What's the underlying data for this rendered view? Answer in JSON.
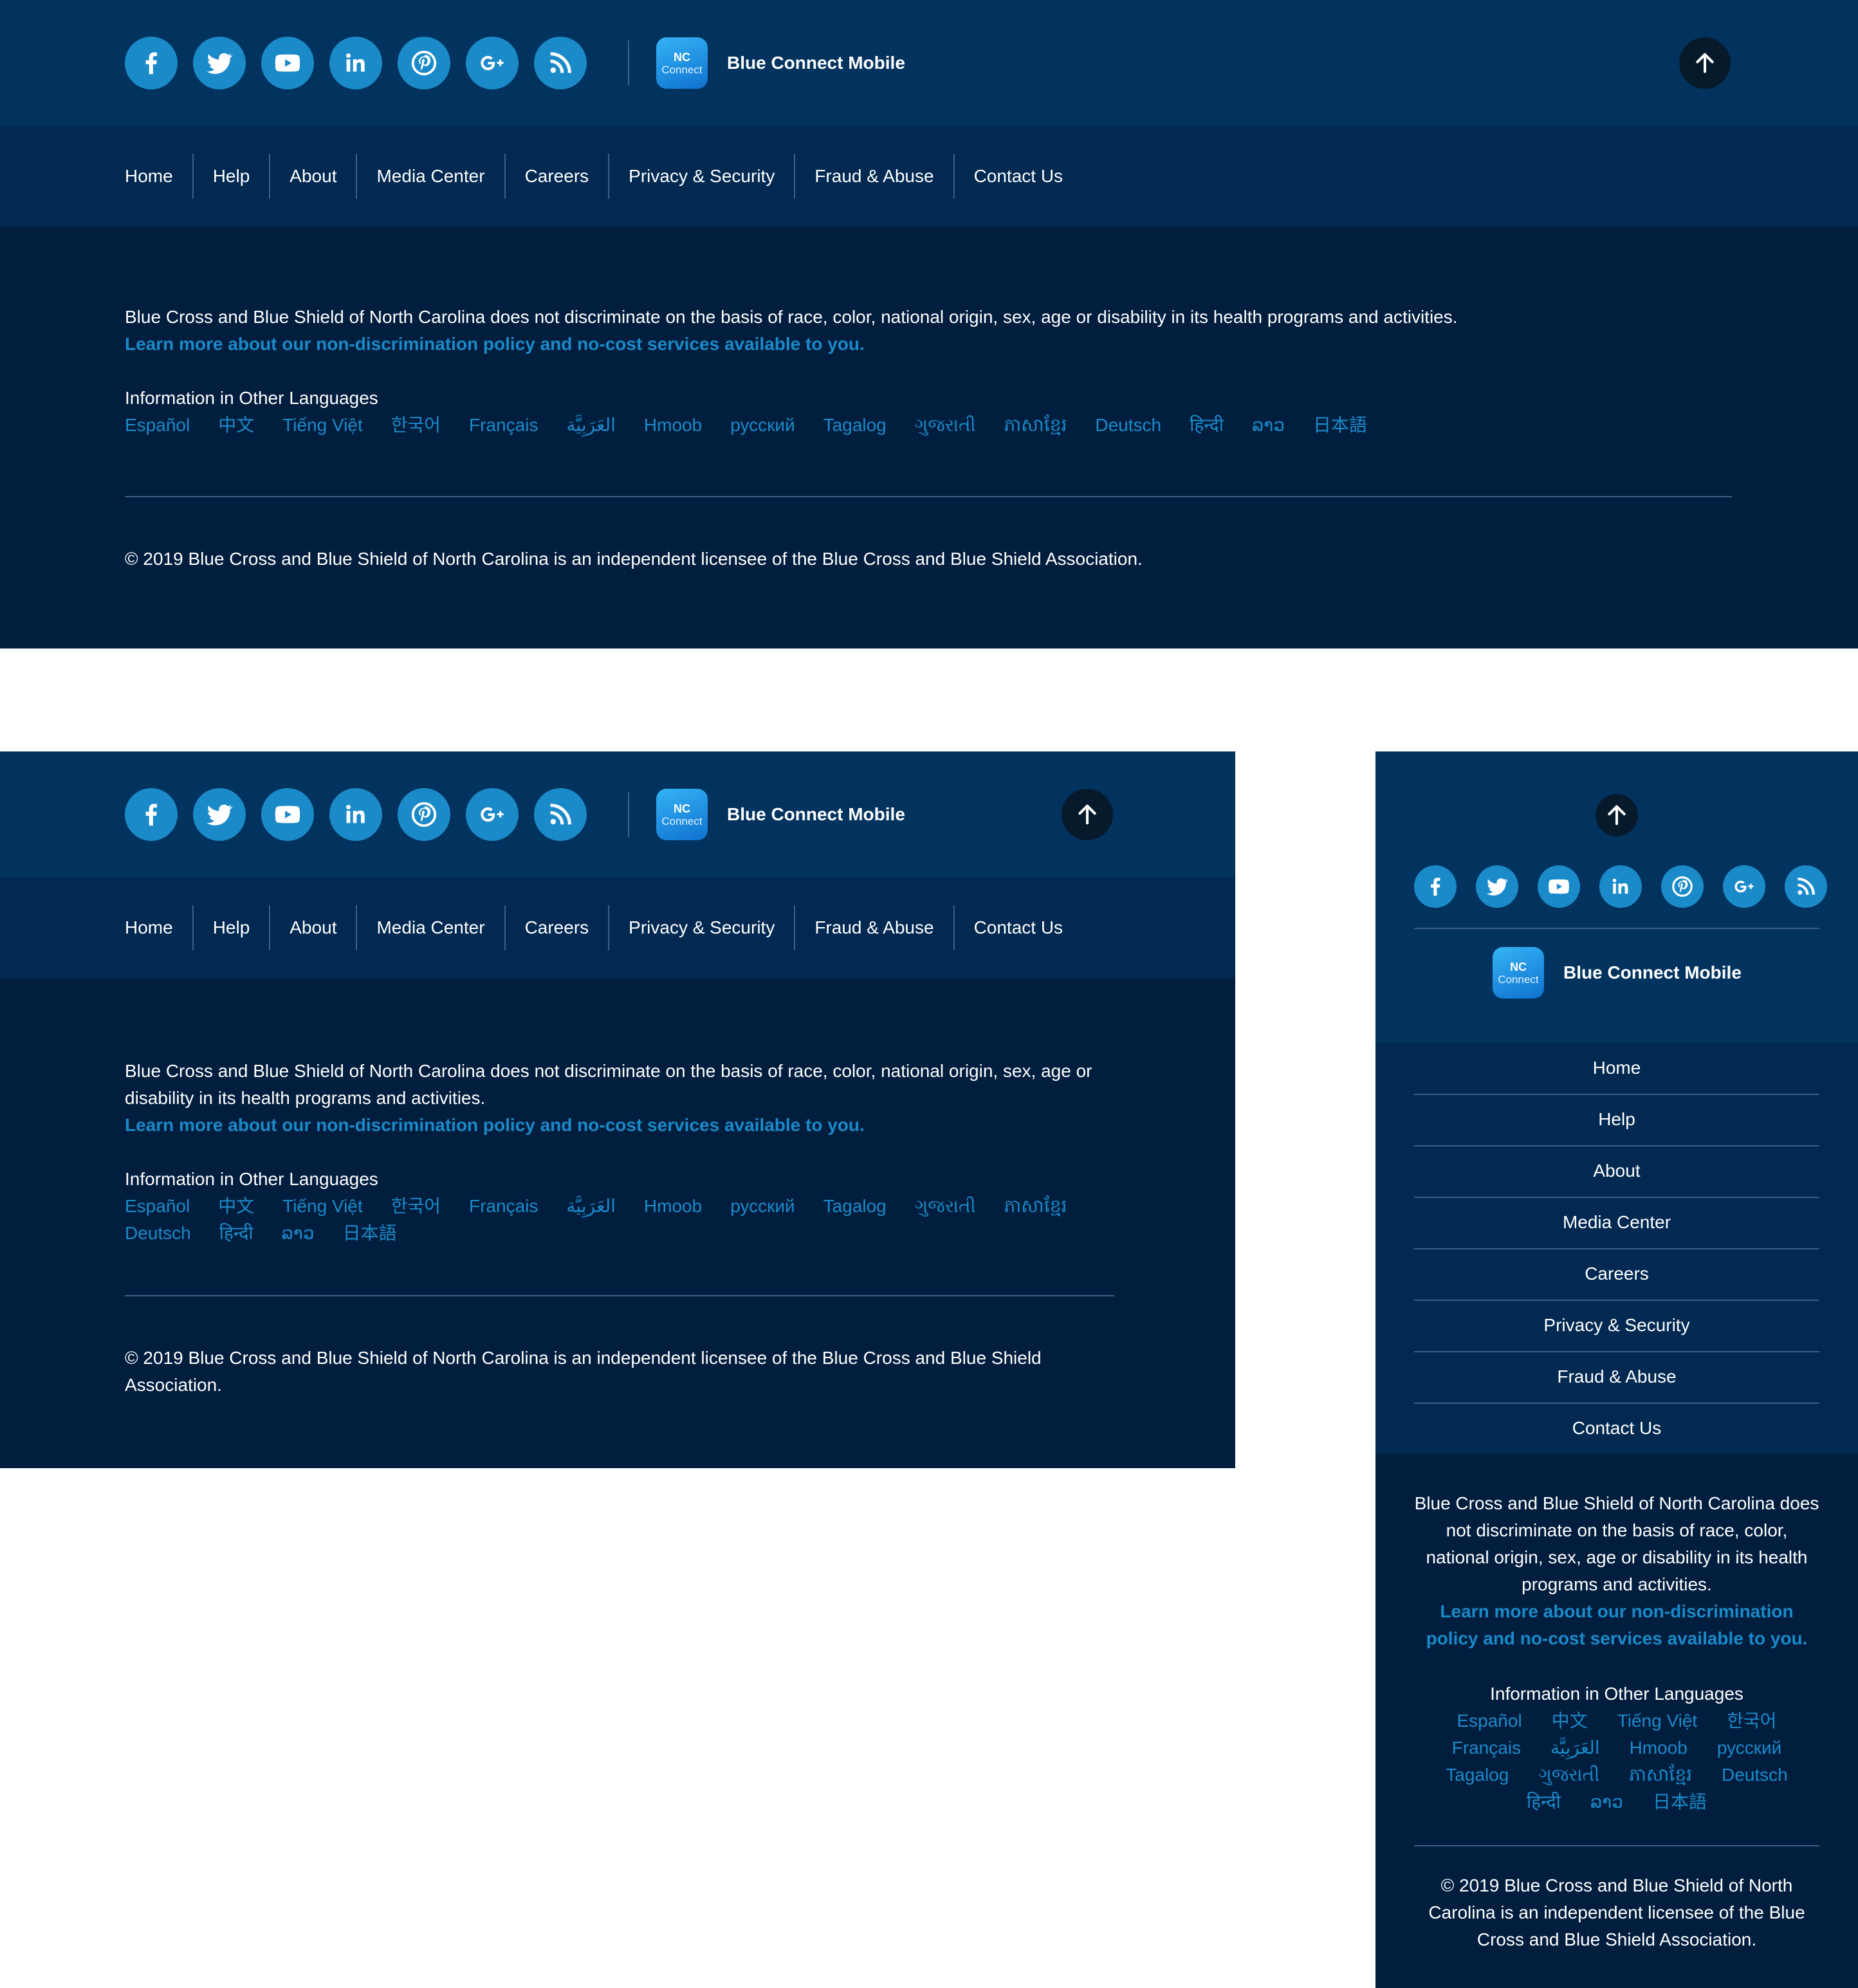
{
  "social_icons": [
    "facebook-icon",
    "twitter-icon",
    "youtube-icon",
    "linkedin-icon",
    "pinterest-icon",
    "google-plus-icon",
    "rss-icon"
  ],
  "app": {
    "icon_line1": "NC",
    "icon_line2": "Connect",
    "label": "Blue Connect Mobile"
  },
  "back_to_top_icon": "arrow-up-icon",
  "nav": [
    "Home",
    "Help",
    "About",
    "Media Center",
    "Careers",
    "Privacy & Security",
    "Fraud & Abuse",
    "Contact Us"
  ],
  "notice": "Blue Cross and Blue Shield of North Carolina does not discriminate on the basis of race, color, national origin, sex, age or disability in its health programs and activities.",
  "notice_link": "Learn more about our non-discrimination policy and no-cost services available to you.",
  "languages_title": "Information in Other Languages",
  "languages": [
    "Español",
    "中文",
    "Tiếng Việt",
    "한국어",
    "Français",
    "العَرَبِيَّة",
    "Hmoob",
    "русский",
    "Tagalog",
    "ગુજરાતી",
    "ភាសាខ្មែរ",
    "Deutsch",
    "हिन्दी",
    "ລາວ",
    "日本語"
  ],
  "copyright": "© 2019 Blue Cross and Blue Shield of North Carolina is an independent licensee of the Blue Cross and Blue Shield Association.",
  "colors": {
    "top_bar": "#02335e",
    "nav_bar": "#012951",
    "body": "#011e3e",
    "accent": "#1b8ac9",
    "back_to_top": "#071a2c"
  }
}
